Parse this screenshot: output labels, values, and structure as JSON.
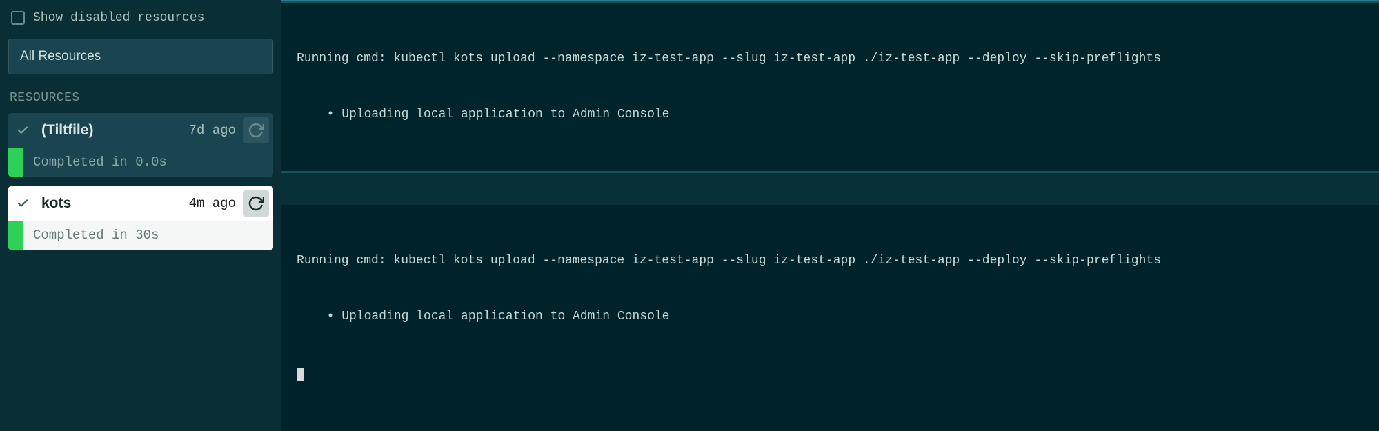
{
  "sidebar": {
    "show_disabled_label": "Show disabled resources",
    "all_resources_label": "All Resources",
    "section_header": "RESOURCES",
    "resources": [
      {
        "name": "(Tiltfile)",
        "time": "7d ago",
        "status": "Completed in 0.0s",
        "selected": false
      },
      {
        "name": "kots",
        "time": "4m ago",
        "status": "Completed in 30s",
        "selected": true
      }
    ]
  },
  "logs": {
    "block1": {
      "line1": "Running cmd: kubectl kots upload --namespace iz-test-app --slug iz-test-app ./iz-test-app --deploy --skip-preflights",
      "line2": "  • Uploading local application to Admin Console"
    },
    "block2": {
      "line1": "Running cmd: kubectl kots upload --namespace iz-test-app --slug iz-test-app ./iz-test-app --deploy --skip-preflights",
      "line2": "  • Uploading local application to Admin Console"
    }
  }
}
